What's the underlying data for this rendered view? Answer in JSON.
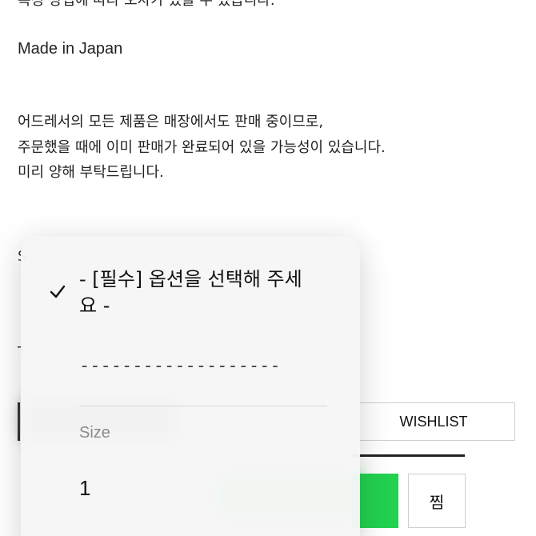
{
  "page": {
    "partial_top_text": "특정 방법에 따라 오차가 있을 수 있습니다.",
    "made_in": "Made in Japan",
    "notice_lines": [
      "어드레서의 모든 제품은 매장에서도 판매 중이므로,",
      "주문했을 때에 이미 판매가 완료되어 있을 가능성이 있습니다.",
      "미리 양해 부탁드립니다."
    ],
    "side_letter_1": "S",
    "side_letter_2": "T"
  },
  "buttons": {
    "wishlist_label": "WISHLIST",
    "zzim_label": "찜"
  },
  "option_menu": {
    "selected_label": "- [필수] 옵션을 선택해 주세요 -",
    "divider_label": "-------------------",
    "section_label": "Size",
    "options": [
      "1"
    ]
  },
  "colors": {
    "naver_green": "#22d14f",
    "popup_bg": "#f6f6f6"
  }
}
